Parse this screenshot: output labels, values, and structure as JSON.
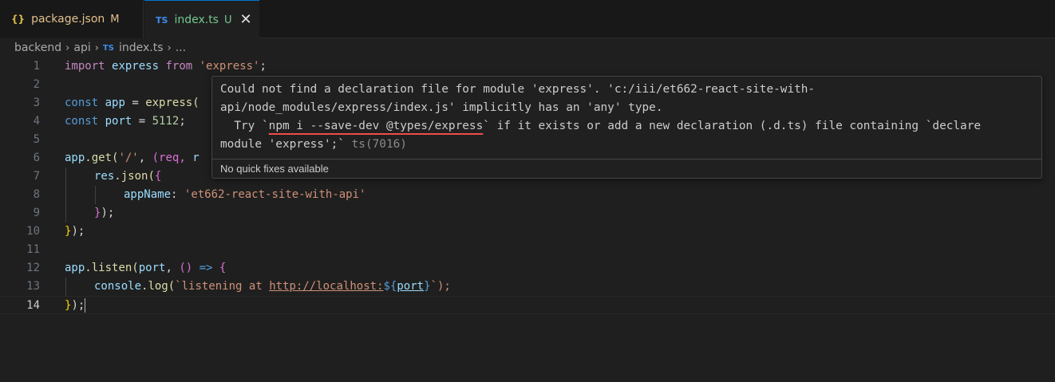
{
  "tabs": [
    {
      "icon": "{}",
      "name": "package.json",
      "status": "M"
    },
    {
      "icon": "TS",
      "name": "index.ts",
      "status": "U",
      "close": "✕"
    }
  ],
  "breadcrumb": {
    "parts": [
      "backend",
      "api",
      "index.ts",
      "..."
    ],
    "ts_icon": "TS",
    "separator": "›"
  },
  "editor": {
    "line_numbers": [
      "1",
      "2",
      "3",
      "4",
      "5",
      "6",
      "7",
      "8",
      "9",
      "10",
      "11",
      "12",
      "13",
      "14"
    ],
    "code": {
      "l1": {
        "kw": "import",
        "id": "express",
        "from": "from",
        "str": "'express'",
        "semi": ";"
      },
      "l3": {
        "kw": "const",
        "id": "app",
        "eq": "=",
        "fn": "express("
      },
      "l4": {
        "kw": "const",
        "id": "port",
        "eq": "=",
        "num": "5112",
        "semi": ";"
      },
      "l6": {
        "obj": "app",
        "fn": ".get(",
        "str": "'/'",
        "comma": ",",
        "p1": "(req,",
        "p2": "r"
      },
      "l7": {
        "obj": "res",
        "fn": ".json(",
        "br": "{"
      },
      "l8": {
        "key": "appName",
        "colon": ":",
        "str": "'et662-react-site-with-api'"
      },
      "l9": {
        "br": "}",
        "rest": ");"
      },
      "l10": {
        "br": "}",
        "rest": ");"
      },
      "l12": {
        "obj": "app",
        "fn": ".listen(",
        "id": "port",
        "comma": ",",
        "args": "()",
        "arrow": "=>",
        "br": "{"
      },
      "l13": {
        "obj": "console",
        "fn": ".log(",
        "tick": "`",
        "t1": "listening",
        "t2": "at",
        "url": "http://localhost:",
        "interp_open": "${",
        "interp_var": "port",
        "interp_close": "}",
        "end": "`);"
      },
      "l14": {
        "br": "}",
        "rest": ");"
      }
    }
  },
  "hover": {
    "line1": "Could not find a declaration file for module 'express'. 'c:/iii/et662-react-site-with-",
    "line2": "api/node_modules/express/index.js' implicitly has an 'any' type.",
    "line3_pre": "  Try `",
    "line3_cmd": "npm i --save-dev @types/express",
    "line3_post": "` if it exists or add a new declaration (.d.ts) file containing `declare",
    "line4": "module 'express';`",
    "code": "ts(7016)",
    "status": "No quick fixes available"
  },
  "colors": {
    "accent": "#0078d4",
    "modified": "#e2c08d",
    "untracked": "#73c991",
    "error": "#f14c4c"
  }
}
